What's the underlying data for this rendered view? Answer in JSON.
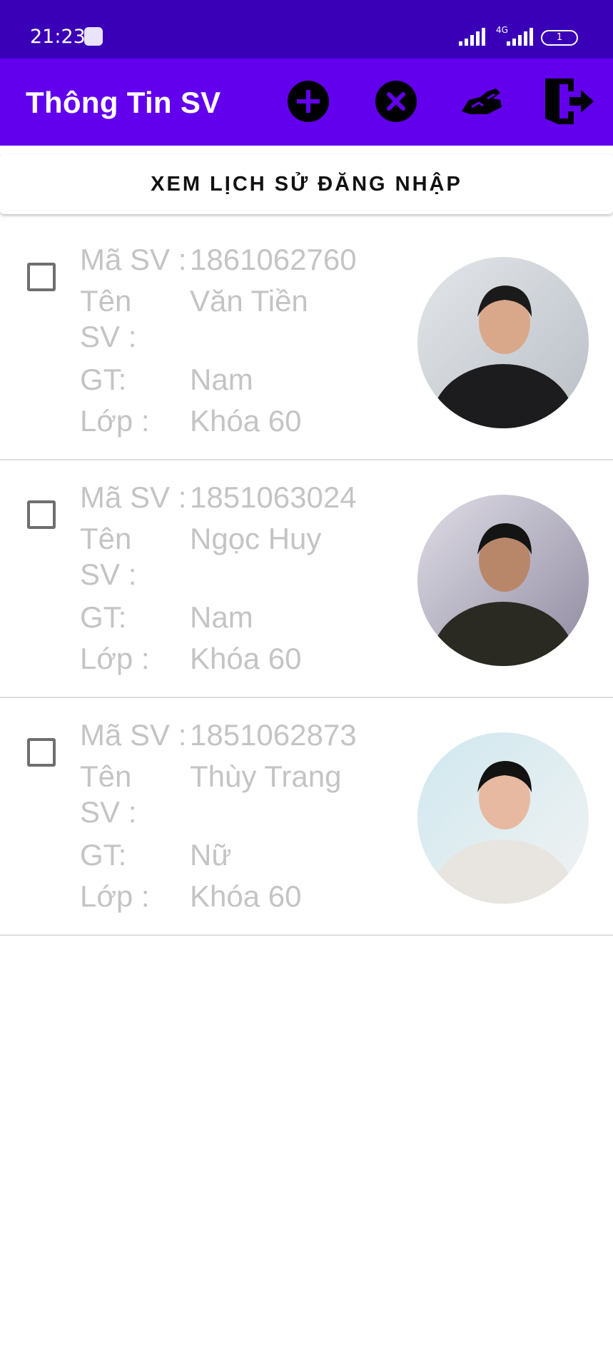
{
  "status_bar": {
    "time": "21:23",
    "network": "4G",
    "battery": "1"
  },
  "app_bar": {
    "title": "Thông Tin SV",
    "icons": [
      "add-circle-icon",
      "cancel-circle-icon",
      "edit-hand-icon",
      "logout-door-icon"
    ]
  },
  "history_button": {
    "label": "XEM LỊCH SỬ ĐĂNG NHẬP"
  },
  "labels": {
    "student_id": "Mã SV :",
    "name_line1": "Tên",
    "name_line2": "SV :",
    "gender": "GT:",
    "class": "Lớp :"
  },
  "students": [
    {
      "id": "1861062760",
      "name": "Văn Tiền",
      "gender": "Nam",
      "class": "Khóa 60",
      "checked": false
    },
    {
      "id": "1851063024",
      "name": "Ngọc Huy",
      "gender": "Nam",
      "class": "Khóa 60",
      "checked": false
    },
    {
      "id": "1851062873",
      "name": "Thùy Trang",
      "gender": "Nữ",
      "class": "Khóa 60",
      "checked": false
    }
  ],
  "colors": {
    "status_bar": "#3a00b8",
    "app_bar": "#6200ee",
    "field_text": "#c4c4c4",
    "divider": "#dedede"
  }
}
